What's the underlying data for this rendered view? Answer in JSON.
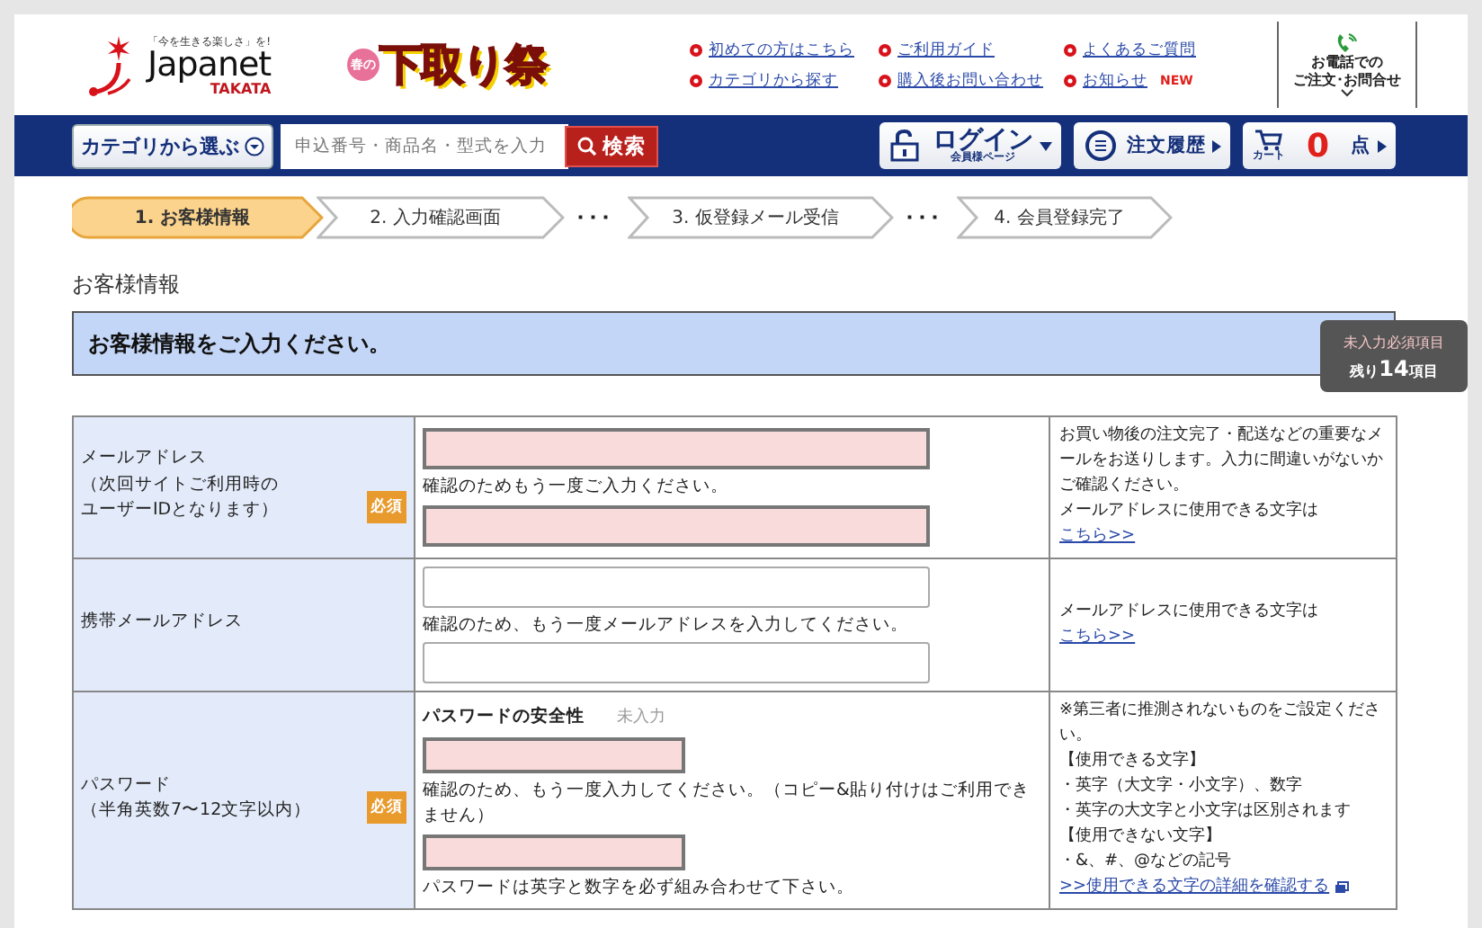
{
  "header": {
    "logo": {
      "tagline": "「今を生きる楽しさ」を!",
      "brand": "Japanet",
      "sub": "TAKATA"
    },
    "campaign": {
      "small": "春の",
      "main": "下取り祭"
    },
    "links": [
      {
        "label": "初めての方はこちら"
      },
      {
        "label": "ご利用ガイド"
      },
      {
        "label": "よくあるご質問"
      },
      {
        "label": "カテゴリから探す"
      },
      {
        "label": "購入後お問い合わせ"
      },
      {
        "label": "お知らせ",
        "badge": "NEW"
      }
    ],
    "phone": {
      "line1": "お電話での",
      "line2": "ご注文･お問合せ"
    }
  },
  "nav": {
    "category": "カテゴリから選ぶ",
    "search": {
      "placeholder": "申込番号・商品名・型式を入力",
      "button": "検索"
    },
    "login": {
      "label": "ログイン",
      "sub": "会員様ページ"
    },
    "history": "注文履歴",
    "cart": {
      "label": "カート",
      "count": "0",
      "unit": "点"
    }
  },
  "steps": [
    {
      "kind": "step",
      "label": "1. お客様情報",
      "selected": true
    },
    {
      "kind": "step",
      "label": "2. 入力確認画面",
      "selected": false
    },
    {
      "kind": "dots",
      "label": "･･･"
    },
    {
      "kind": "step",
      "label": "3. 仮登録メール受信",
      "selected": false
    },
    {
      "kind": "dots",
      "label": "･･･"
    },
    {
      "kind": "step",
      "label": "4. 会員登録完了",
      "selected": false
    }
  ],
  "section_title": "お客様情報",
  "banner": "お客様情報をご入力ください。",
  "remaining": {
    "title": "未入力必須項目",
    "prefix": "残り",
    "count": "14",
    "suffix": "項目"
  },
  "rows": [
    {
      "label": [
        "メールアドレス",
        "（次回サイトご利用時の",
        "ユーザーIDとなります）"
      ],
      "required": true,
      "badge": "必須",
      "fields": [
        {
          "kind": "input",
          "invalid": true
        },
        {
          "kind": "hint",
          "text": " 確認のためもう一度ご入力ください。"
        },
        {
          "kind": "input",
          "invalid": true
        }
      ],
      "note": {
        "lines": [
          "お買い物後の注文完了・配送などの重要なメールをお送りします。入力に間違いがないかご確認ください。"
        ],
        "prefix": "メールアドレスに使用できる文字は",
        "link": "こちら>>"
      }
    },
    {
      "label": [
        "携帯メールアドレス"
      ],
      "required": false,
      "fields": [
        {
          "kind": "input",
          "invalid": false
        },
        {
          "kind": "hint",
          "text": "確認のため、もう一度メールアドレスを入力してください。"
        },
        {
          "kind": "input",
          "invalid": false
        }
      ],
      "note": {
        "prefix": "メールアドレスに使用できる文字は",
        "link": "こちら>>"
      }
    },
    {
      "label": [
        "パスワード",
        "（半角英数7〜12文字以内）"
      ],
      "required": true,
      "badge": "必須",
      "fields": [
        {
          "kind": "strength",
          "label": "パスワードの安全性",
          "value": "未入力"
        },
        {
          "kind": "short_input",
          "invalid": true
        },
        {
          "kind": "hint",
          "text": "確認のため、もう一度入力してください。（コピー&貼り付けはご利用できません）"
        },
        {
          "kind": "short_input",
          "invalid": true
        },
        {
          "kind": "hint",
          "text": "パスワードは英字と数字を必ず組み合わせて下さい。"
        }
      ],
      "note": {
        "lines": [
          "※第三者に推測されないものをご設定ください。",
          "【使用できる文字】",
          "・英字（大文字・小文字）、数字",
          "・英字の大文字と小文字は区別されます",
          "【使用できない文字】",
          "・&、#、@などの記号"
        ],
        "link": ">>使用できる文字の詳細を確認する",
        "external": true
      }
    }
  ]
}
